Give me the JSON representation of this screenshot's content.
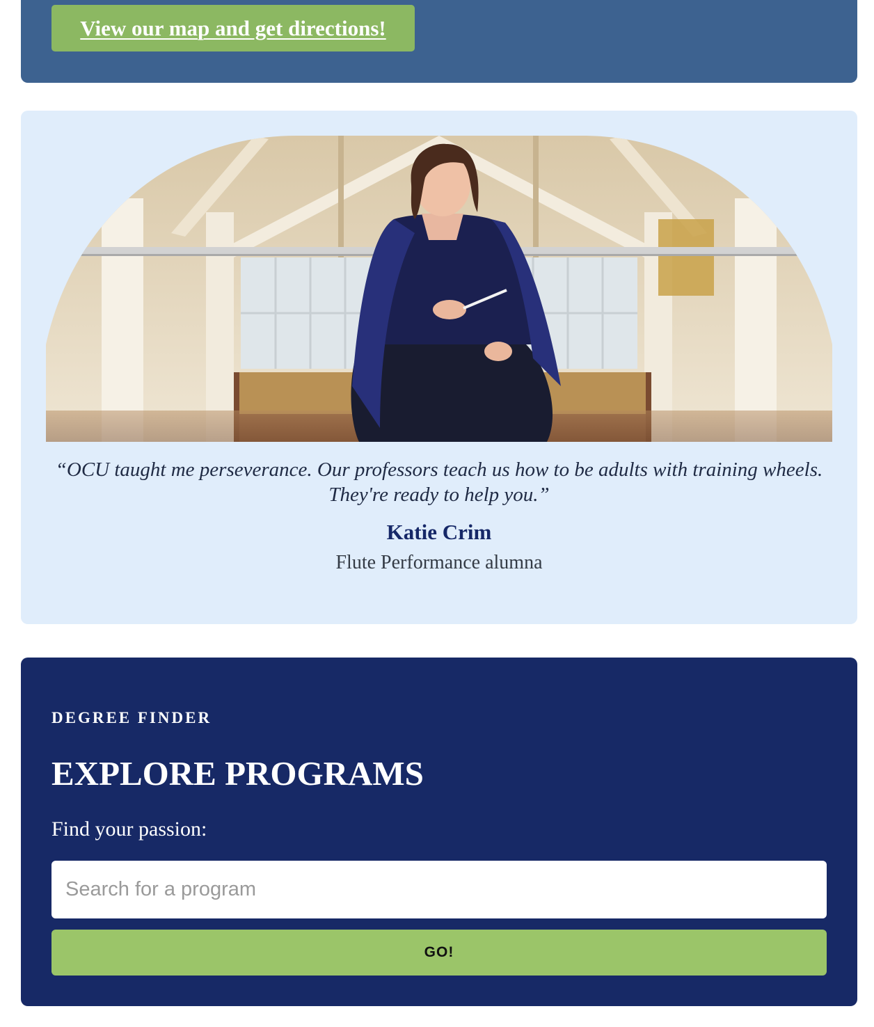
{
  "map_card": {
    "button_label": "View our map and get directions!"
  },
  "testimonial": {
    "photo": {
      "subject": "Woman in a dark sequined outfit seated on a bench holding a baton in a chapel"
    },
    "quote": "“OCU taught me perseverance. Our professors teach us how to be adults with training wheels. They're ready to help you.”",
    "name": "Katie Crim",
    "role": "Flute Performance alumna"
  },
  "degree_finder": {
    "eyebrow": "DEGREE FINDER",
    "heading": "EXPLORE PROGRAMS",
    "label": "Find your passion:",
    "search_placeholder": "Search for a program",
    "search_value": "",
    "go_label": "GO!"
  },
  "colors": {
    "map_card_bg": "#3d6290",
    "testimonial_bg": "#e0edfb",
    "finder_bg": "#172966",
    "accent_green": "#9bc569",
    "name_navy": "#162868"
  }
}
